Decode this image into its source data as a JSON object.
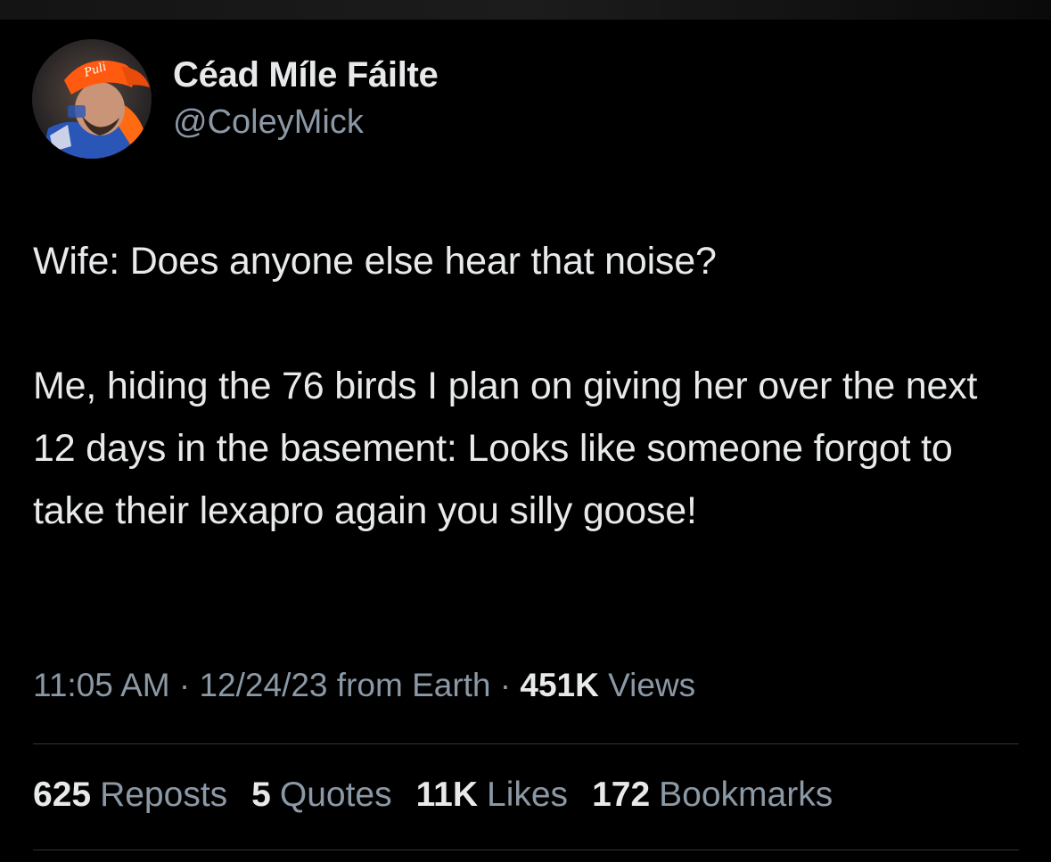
{
  "author": {
    "display_name": "Céad Míle Fáilte",
    "handle": "@ColeyMick",
    "avatar_icon": "profile-photo-orange-cap"
  },
  "tweet": {
    "paragraphs": [
      "Wife: Does anyone else hear that noise?",
      "Me, hiding the 76 birds I plan on giving her over the next 12 days in the basement: Looks like someone forgot to take their lexapro again you silly goose!"
    ]
  },
  "meta": {
    "time": "11:05 AM",
    "separator": "·",
    "date": "12/24/23",
    "source": "from Earth",
    "views_count": "451K",
    "views_label": "Views"
  },
  "stats": {
    "reposts": {
      "count": "625",
      "label": "Reposts"
    },
    "quotes": {
      "count": "5",
      "label": "Quotes"
    },
    "likes": {
      "count": "11K",
      "label": "Likes"
    },
    "bookmarks": {
      "count": "172",
      "label": "Bookmarks"
    }
  },
  "colors": {
    "background": "#000000",
    "primary_text": "#e7e9ea",
    "secondary_text": "#8b98a5",
    "divider": "#2f3336"
  }
}
